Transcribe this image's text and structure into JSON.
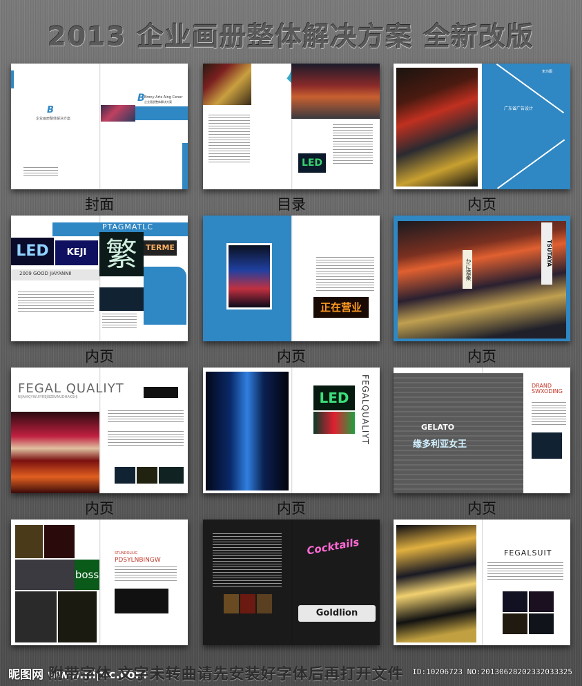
{
  "title": "2013 企业画册整体解决方案  全新改版",
  "captions": [
    "封面",
    "目录",
    "内页",
    "内页",
    "内页",
    "内页",
    "内页",
    "内页",
    "内页"
  ],
  "cover": {
    "brand": "Brony Arts Aing Cener",
    "brand_sub": "企业画册整体解决方案",
    "small_title": "企业画册整体解决方案"
  },
  "p3": {
    "label": "广东省广告设计",
    "tag": "宋为图"
  },
  "p4": {
    "heading": "PTAGMATLC",
    "year_line": "2009  GOOD JIAYANNII",
    "led": "LED",
    "keji": "KEJI",
    "big_char": "繁",
    "term": "TERME"
  },
  "p5": {
    "sign": "正在营业"
  },
  "p6": {
    "sign1": "TSUTAYA",
    "sign2": "かに道楽"
  },
  "p7": {
    "heading": "FEGAL QUALIYT",
    "sub": "NIJAHKJYWUIYREJBZBVNUDHAKSHJ"
  },
  "p8": {
    "vertical_text": "FEGALQUALIYT",
    "led": "LED"
  },
  "p9": {
    "heading1": "DRAND",
    "heading2": "SWXODING",
    "shop": "GELATO",
    "shop_cn": "缘多利亚女王"
  },
  "p10": {
    "heading1": "STUNDOLIUG",
    "heading2": "PDSYLNBINGW",
    "boss": "boss"
  },
  "p11": {
    "neon1": "Cocktails",
    "neon2": "Goldlion"
  },
  "p12": {
    "heading": "FEGALSUIT"
  },
  "footer": {
    "logo": "昵图网 www.nipic.com",
    "notice": "附带字体 文字未转曲请先安装好字体后再打开文件",
    "id": "ID:10206723 NO:20130628202332033325"
  },
  "colors": {
    "accent_blue": "#2f87c3",
    "dark": "#111111"
  }
}
